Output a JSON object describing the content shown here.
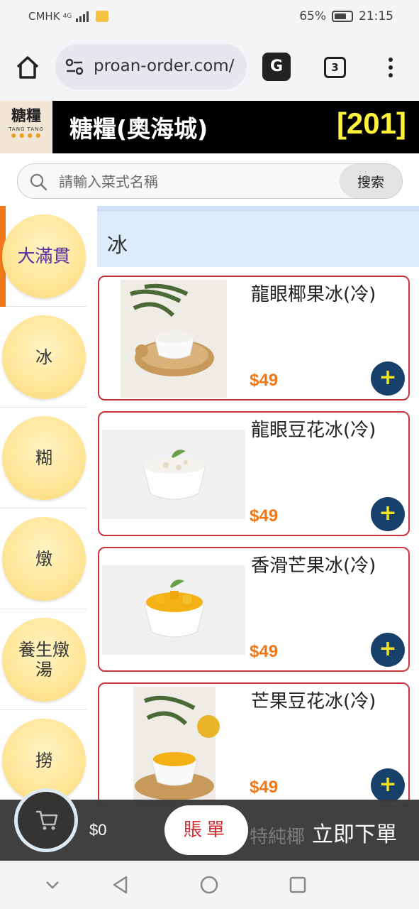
{
  "status_bar": {
    "carrier": "CMHK",
    "network": "4G",
    "battery": "65%",
    "time": "21:15"
  },
  "browser": {
    "url": "proan-order.com/",
    "tab_count": "3",
    "translate_label": "G"
  },
  "store": {
    "logo_text": "糖糧",
    "logo_subtitle": "TANG TANG",
    "name": "糖糧(奧海城)",
    "table_number": "[201]"
  },
  "search": {
    "placeholder": "請輸入菜式名稱",
    "button_label": "搜索"
  },
  "categories": [
    "大滿貫",
    "冰",
    "糊",
    "燉",
    "養生燉湯",
    "撈"
  ],
  "section": {
    "title": "冰"
  },
  "products": [
    {
      "name": "龍眼椰果冰(冷)",
      "price": "$49"
    },
    {
      "name": "龍眼豆花冰(冷)",
      "price": "$49"
    },
    {
      "name": "香滑芒果冰(冷)",
      "price": "$49"
    },
    {
      "name": "芒果豆花冰(冷)",
      "price": "$49"
    }
  ],
  "add_button_label": "+",
  "bottom_bar": {
    "cart_total": "$0",
    "bill_label": "賬單",
    "peek_text": "特純椰",
    "order_label": "立即下單"
  },
  "colors": {
    "accent_orange": "#f07818",
    "border_red": "#c9343a",
    "add_button": "#17406a",
    "table_no_yellow": "#fff23a"
  }
}
